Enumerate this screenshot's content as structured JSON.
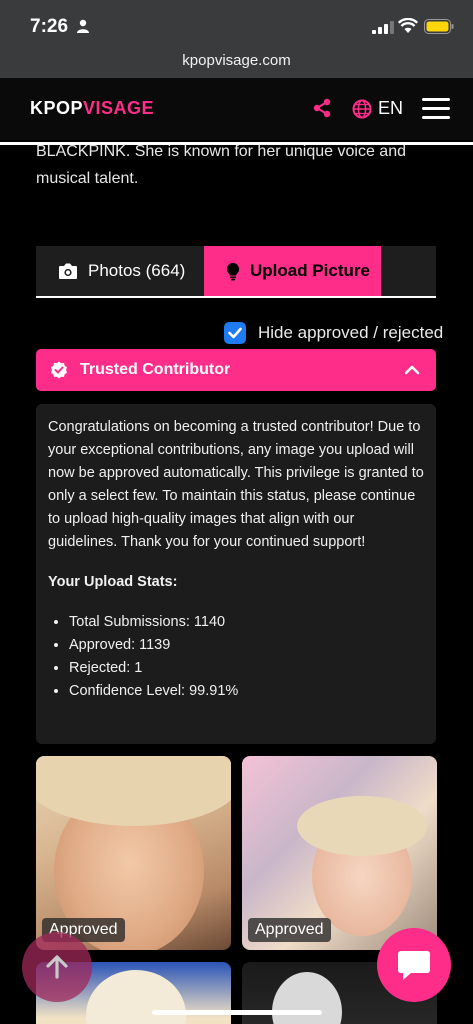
{
  "status_bar": {
    "time": "7:26"
  },
  "browser": {
    "url": "kpopvisage.com"
  },
  "header": {
    "logo_part1": "KPOP",
    "logo_part2": "VISAGE",
    "language": "EN"
  },
  "bio_text": "BLACKPINK. She is known for her unique voice and musical talent.",
  "tabs": [
    {
      "label": "Photos (664)",
      "active": false
    },
    {
      "label": "Upload Picture",
      "active": true
    }
  ],
  "filter": {
    "label": "Hide approved / rejected",
    "checked": true
  },
  "trusted": {
    "title": "Trusted Contributor",
    "message": "Congratulations on becoming a trusted contributor! Due to your exceptional contributions, any image you upload will now be approved automatically. This privilege is granted to only a select few. To maintain this status, please continue to upload high-quality images that align with our guidelines. Thank you for your continued support!",
    "stats_title": "Your Upload Stats:",
    "stats": [
      "Total Submissions: 1140",
      "Approved: 1139",
      "Rejected: 1",
      "Confidence Level: 99.91%"
    ]
  },
  "gallery": [
    {
      "status": "Approved"
    },
    {
      "status": "Approved"
    }
  ],
  "colors": {
    "accent": "#ff2d8a",
    "background": "#000000",
    "panel": "#1c1c1c",
    "checkbox": "#1f7bf2"
  }
}
